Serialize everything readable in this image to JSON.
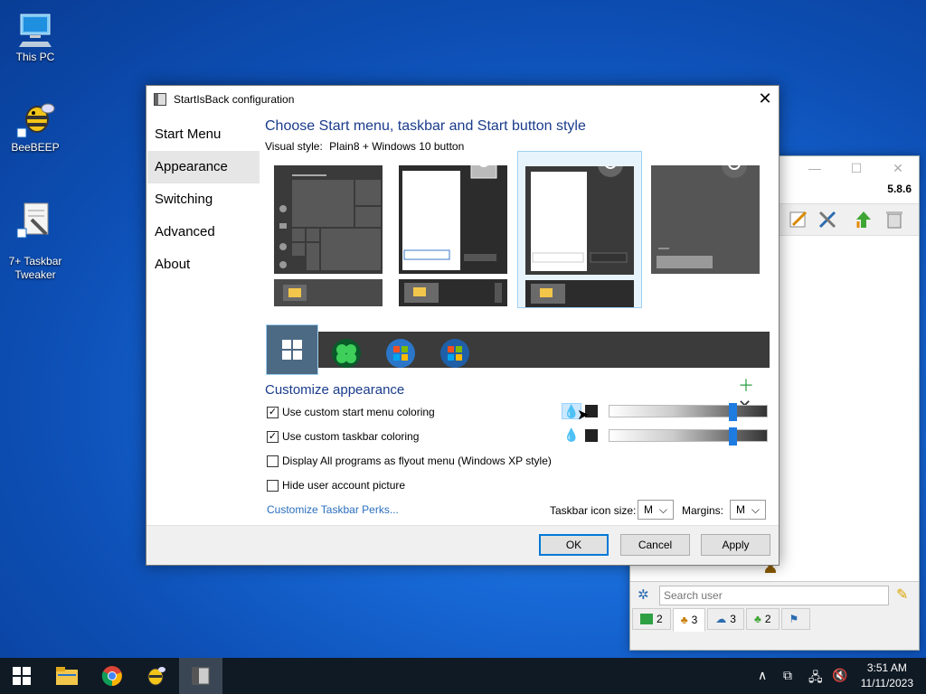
{
  "desktop": {
    "icons": [
      {
        "label": "This PC"
      },
      {
        "label": "BeeBEEP"
      },
      {
        "label": "7+ Taskbar\nTweaker"
      }
    ]
  },
  "background_window": {
    "version": "5.8.6",
    "search_placeholder": "Search user",
    "tabs": [
      {
        "count": "2"
      },
      {
        "count": "3"
      },
      {
        "count": "3"
      },
      {
        "count": "2"
      },
      {
        "count": ""
      }
    ]
  },
  "dialog": {
    "title": "StartIsBack configuration",
    "nav": [
      {
        "label": "Start Menu"
      },
      {
        "label": "Appearance"
      },
      {
        "label": "Switching"
      },
      {
        "label": "Advanced"
      },
      {
        "label": "About"
      }
    ],
    "heading": "Choose Start menu, taskbar and Start button style",
    "visual_style_label": "Visual style:",
    "visual_style_value": "Plain8 + Windows 10 button",
    "customize_heading": "Customize appearance",
    "options": [
      {
        "label": "Use custom start menu coloring",
        "checked": true
      },
      {
        "label": "Use custom taskbar coloring",
        "checked": true
      },
      {
        "label": "Display All programs as flyout menu (Windows XP style)",
        "checked": false
      },
      {
        "label": "Hide user account picture",
        "checked": false
      }
    ],
    "start_menu_slider": 0.75,
    "taskbar_slider": 0.75,
    "link": "Customize Taskbar Perks...",
    "icon_size_label": "Taskbar icon size:",
    "icon_size_value": "M",
    "margins_label": "Margins:",
    "margins_value": "M",
    "buttons": {
      "ok": "OK",
      "cancel": "Cancel",
      "apply": "Apply"
    }
  },
  "taskbar": {
    "time": "3:51 AM",
    "date": "11/11/2023"
  },
  "colors": {
    "accent": "#1a3c8c",
    "link": "#2a6ebd",
    "slider_thumb": "#1e7be0",
    "taskbar": "#101a24"
  }
}
